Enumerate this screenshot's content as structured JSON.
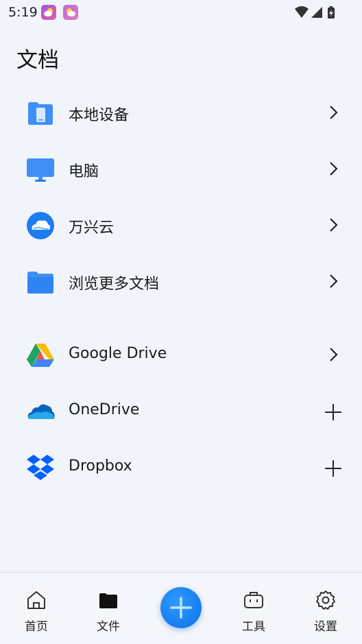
{
  "status_bar": {
    "time": "5:19",
    "icons": [
      "weather-notification-icon",
      "weather-notification-icon",
      "wifi-icon",
      "signal-icon",
      "battery-icon"
    ]
  },
  "page": {
    "title": "文档"
  },
  "local_section": [
    {
      "label": "本地设备",
      "icon": "phone-folder-icon",
      "action": "chevron"
    },
    {
      "label": "电脑",
      "icon": "monitor-icon",
      "action": "chevron"
    },
    {
      "label": "万兴云",
      "icon": "cloud-icon",
      "action": "chevron"
    },
    {
      "label": "浏览更多文档",
      "icon": "folder-icon",
      "action": "chevron"
    }
  ],
  "cloud_section": [
    {
      "label": "Google Drive",
      "icon": "google-drive-icon",
      "action": "chevron"
    },
    {
      "label": "OneDrive",
      "icon": "onedrive-icon",
      "action": "plus"
    },
    {
      "label": "Dropbox",
      "icon": "dropbox-icon",
      "action": "plus"
    }
  ],
  "bottom_nav": {
    "items": [
      {
        "label": "首页",
        "icon": "home-icon",
        "active": false
      },
      {
        "label": "文件",
        "icon": "folder-icon",
        "active": true
      },
      {
        "label": "工具",
        "icon": "toolbox-icon",
        "active": false
      },
      {
        "label": "设置",
        "icon": "gear-icon",
        "active": false
      }
    ],
    "fab_icon": "plus-icon"
  },
  "colors": {
    "accent": "#1a7ef0",
    "background": "#f1f4fb"
  }
}
